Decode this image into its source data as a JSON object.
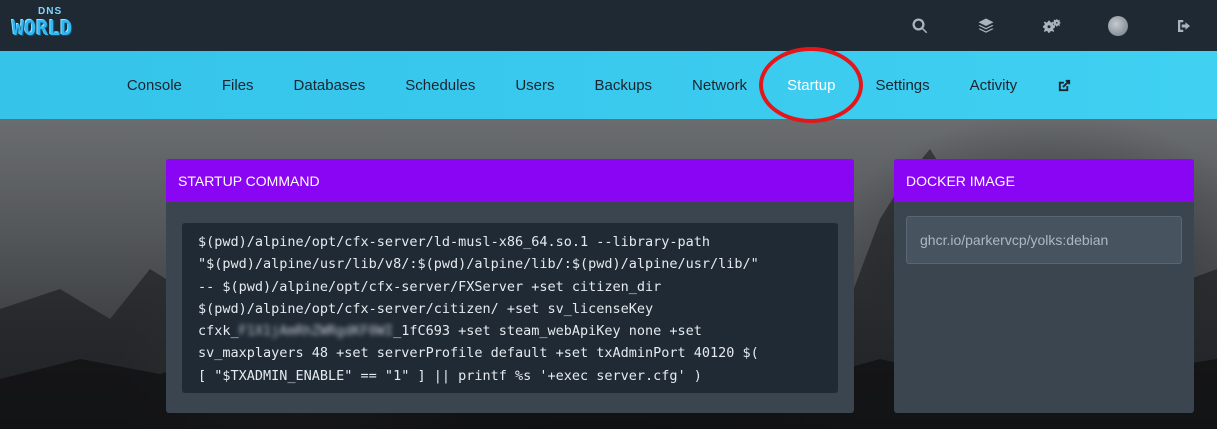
{
  "brand": {
    "logo_top": "DNS",
    "logo_main": "WORLD"
  },
  "topbar": {
    "icons": [
      "search-icon",
      "layers-icon",
      "cogs-icon",
      "avatar",
      "sign-out-icon"
    ]
  },
  "nav": {
    "items": [
      {
        "label": "Console"
      },
      {
        "label": "Files"
      },
      {
        "label": "Databases"
      },
      {
        "label": "Schedules"
      },
      {
        "label": "Users"
      },
      {
        "label": "Backups"
      },
      {
        "label": "Network"
      },
      {
        "label": "Startup",
        "active": true
      },
      {
        "label": "Settings"
      },
      {
        "label": "Activity"
      }
    ],
    "external_icon": "external-link-icon"
  },
  "startup": {
    "title": "STARTUP COMMAND",
    "lines": [
      "$(pwd)/alpine/opt/cfx-server/ld-musl-x86_64.so.1 --library-path",
      "\"$(pwd)/alpine/usr/lib/v8/:$(pwd)/alpine/lib/:$(pwd)/alpine/usr/lib/\"",
      "-- $(pwd)/alpine/opt/cfx-server/FXServer +set citizen_dir",
      "$(pwd)/alpine/opt/cfx-server/citizen/ +set sv_licenseKey"
    ],
    "line5_prefix": "cfxk_",
    "line5_redacted": "F1X1jAmRhZWRgdKF0WI",
    "line5_suffix": "_1fC693 +set steam_webApiKey none +set",
    "lines_after": [
      "sv_maxplayers 48 +set serverProfile default +set txAdminPort 40120 $(",
      "[ \"$TXADMIN_ENABLE\" == \"1\" ] || printf %s '+exec server.cfg' )"
    ]
  },
  "docker": {
    "title": "DOCKER IMAGE",
    "image": "ghcr.io/parkervcp/yolks:debian"
  },
  "colors": {
    "topbar": "#1f2933",
    "subnav": "#3fd0f2",
    "panel_head": "#8b05f5",
    "highlight_circle": "#e3171b"
  }
}
